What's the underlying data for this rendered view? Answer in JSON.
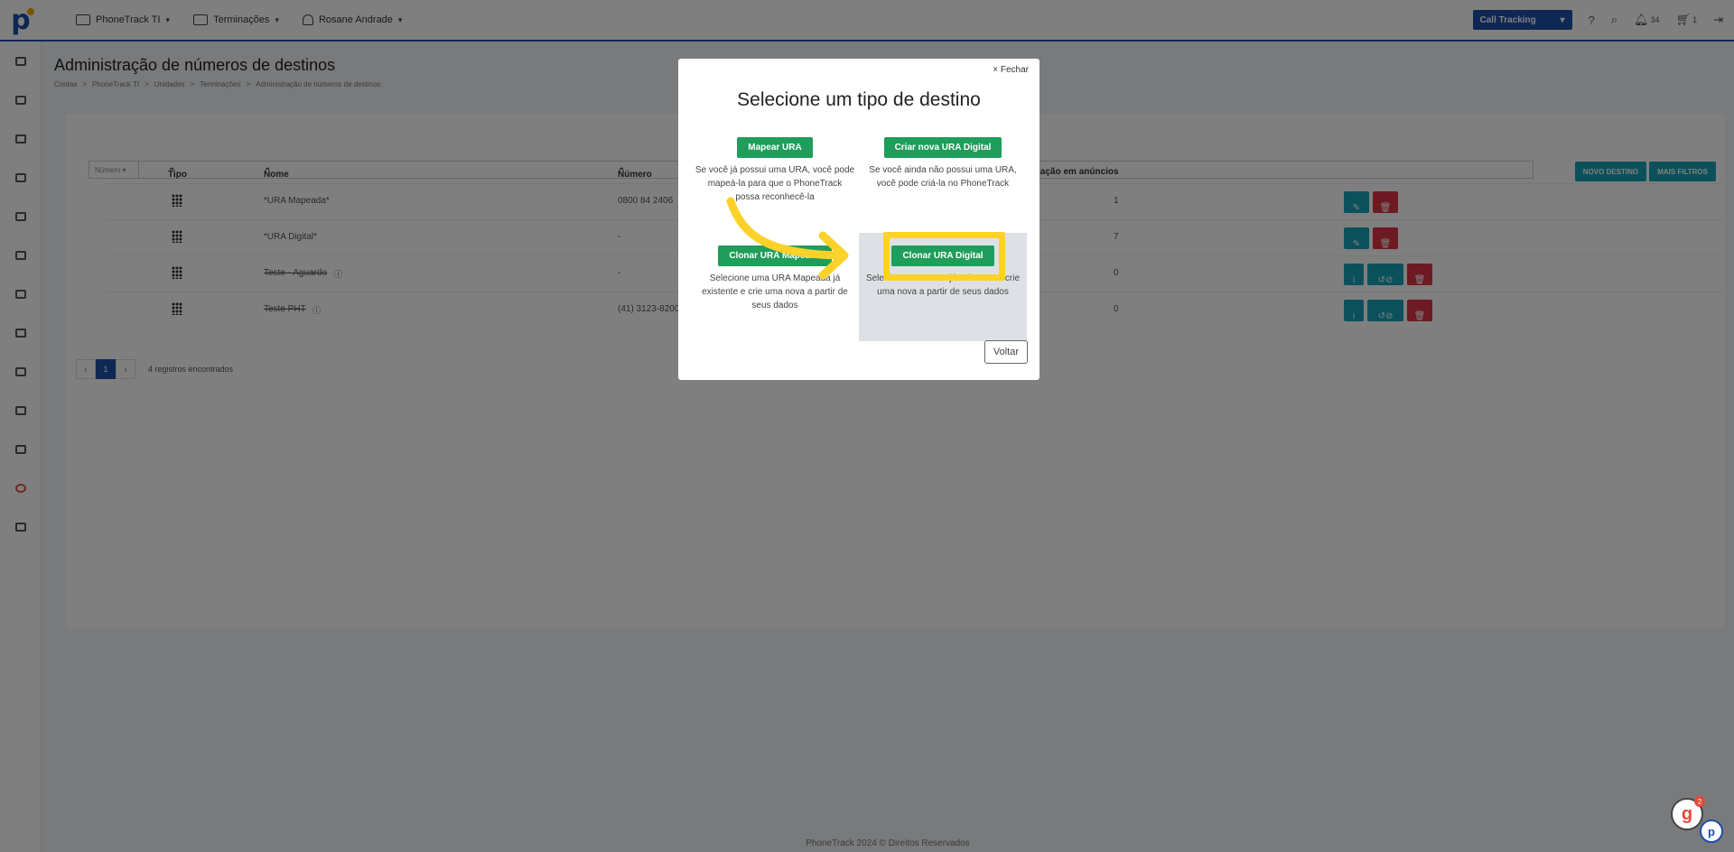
{
  "topbar": {
    "nav": [
      {
        "label": "PhoneTrack TI",
        "icon": "briefcase-icon"
      },
      {
        "label": "Terminações",
        "icon": "briefcase-icon"
      },
      {
        "label": "Rosane Andrade",
        "icon": "user-icon"
      }
    ],
    "product_select": "Call Tracking",
    "notifications_count": "34",
    "cart_count": "1"
  },
  "page": {
    "title": "Administração de números de destinos",
    "breadcrumb": [
      "Contas",
      ">",
      "PhoneTrack TI",
      ">",
      "Unidades",
      ">",
      "Terminações",
      ">",
      "Administração de números de destinos"
    ],
    "filter_select": "Número",
    "btn_new": "NOVO DESTINO",
    "btn_filters": "MAIS FILTROS"
  },
  "table": {
    "headers": {
      "tipo": "Tipo",
      "nome": "Nome",
      "numero": "Número",
      "uso": "Utilização em anúncios"
    },
    "rows": [
      {
        "nome": "*URA Mapeada*",
        "numero": "0800 84 2406",
        "uso": "1",
        "strike": false
      },
      {
        "nome": "*URA Digital*",
        "numero": "-",
        "uso": "7",
        "strike": false
      },
      {
        "nome": "Teste - Aguardo",
        "numero": "-",
        "uso": "0",
        "strike": true
      },
      {
        "nome": "Teste PHT",
        "numero": "(41) 3123-8200",
        "uso": "0",
        "strike": true
      }
    ]
  },
  "pager": {
    "prev": "‹",
    "page": "1",
    "next": "›",
    "count": "4 registros encontrados"
  },
  "footer": "PhoneTrack 2024 © Direitos Reservados",
  "modal": {
    "close": "× Fechar",
    "title": "Selecione um tipo de destino",
    "options": [
      {
        "button": "Mapear URA",
        "desc": "Se você já possui uma URA, você pode mapeá-la para que o PhoneTrack possa reconhecê-la"
      },
      {
        "button": "Criar nova URA Digital",
        "desc": "Se você ainda não possui uma URA, você pode criá-la no PhoneTrack"
      },
      {
        "button": "Clonar URA Mapeada",
        "desc": "Selecione uma URA Mapeada já existente e crie uma nova a partir de seus dados"
      },
      {
        "button": "Clonar URA Digital",
        "desc": "Selecione uma URA já existente e crie uma nova a partir de seus dados"
      }
    ],
    "back": "Voltar"
  },
  "chat": {
    "badge": "2"
  },
  "colors": {
    "brand": "#1f4ea8",
    "teal": "#17a2b8",
    "danger": "#dc3545",
    "success": "#1e9e5a",
    "highlight": "#fcd12a"
  }
}
